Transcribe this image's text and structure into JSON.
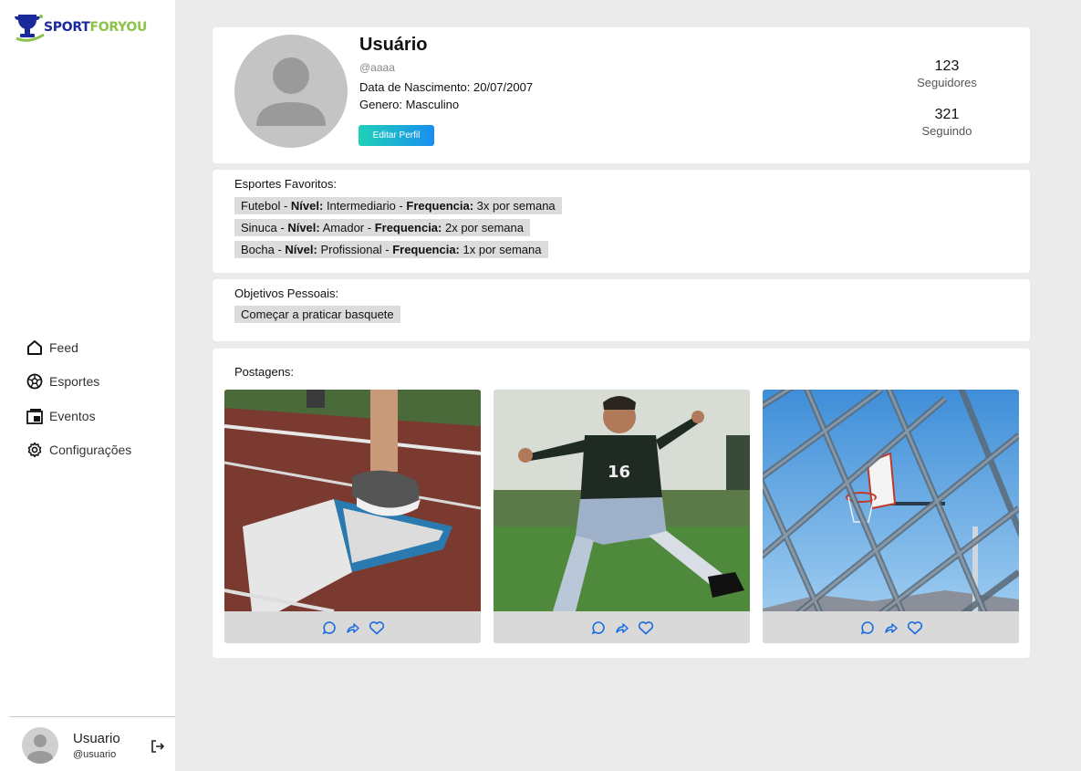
{
  "brand": {
    "part1": "SPORT",
    "part2": "FORYOU"
  },
  "nav": [
    {
      "label": "Feed",
      "icon": "home-icon"
    },
    {
      "label": "Esportes",
      "icon": "soccer-ball-icon"
    },
    {
      "label": "Eventos",
      "icon": "events-icon"
    },
    {
      "label": "Configurações",
      "icon": "gear-icon"
    }
  ],
  "current_user": {
    "name": "Usuario",
    "handle": "@usuario"
  },
  "profile": {
    "name": "Usuário",
    "handle": "@aaaa",
    "birth": "Data de Nascimento: 20/07/2007",
    "gender": "Genero: Masculino",
    "edit_label": "Editar Perfil",
    "followers_count": "123",
    "followers_label": "Seguidores",
    "following_count": "321",
    "following_label": "Seguindo"
  },
  "sports": {
    "title": "Esportes Favoritos:",
    "items": [
      {
        "sport": "Futebol - ",
        "level_label": "Nível:",
        "level": " Intermediario - ",
        "freq_label": "Frequencia:",
        "freq": " 3x por semana"
      },
      {
        "sport": "Sinuca - ",
        "level_label": "Nível:",
        "level": " Amador - ",
        "freq_label": "Frequencia:",
        "freq": " 2x por semana"
      },
      {
        "sport": "Bocha - ",
        "level_label": "Nível:",
        "level": " Profissional - ",
        "freq_label": "Frequencia:",
        "freq": " 1x por semana"
      }
    ]
  },
  "goals": {
    "title": "Objetivos Pessoais:",
    "items": [
      "Começar a praticar basquete"
    ]
  },
  "posts": {
    "title": "Postagens:",
    "items": [
      {
        "image": "running-track-photo"
      },
      {
        "image": "soccer-player-photo"
      },
      {
        "image": "basketball-hoop-fence-photo"
      }
    ]
  },
  "colors": {
    "brand_blue": "#1a2a9a",
    "brand_green": "#8bc34a",
    "action_blue": "#1a6be0",
    "button_gradient_start": "#1fd1b8",
    "button_gradient_end": "#1a8ef0"
  }
}
